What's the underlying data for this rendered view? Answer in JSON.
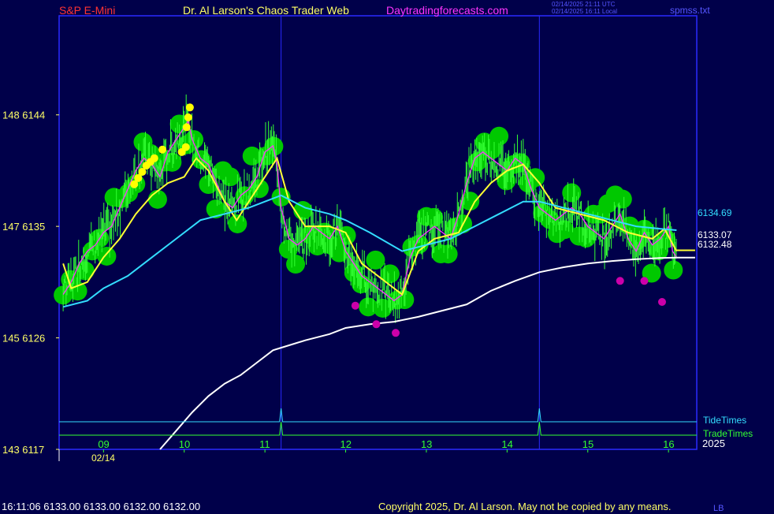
{
  "header": {
    "symbol": "S&P E-Mini",
    "site_title": "Dr. Al Larson's Chaos Trader Web",
    "site_url": "Daytradingforecasts.com",
    "time_utc": "02/14/2025 21:11 UTC",
    "time_local": "02/14/2025 16:11 Local",
    "file_name": "spmss.txt"
  },
  "footer": {
    "quote_line": "16:11:06  6133.00 6133.00 6132.00 6132.00",
    "copyright": "Copyright 2025, Dr. Al Larson. May not be copied by any means.",
    "corner_tag": "LB"
  },
  "colors": {
    "background": "#00004a",
    "axis": "#2a2aff",
    "price_bars": "#33ff33",
    "green_circles": "#00c800",
    "yellow_line": "#ffff33",
    "magenta_line": "#ff33ff",
    "cyan_line": "#33ddff",
    "white_line": "#ffffff",
    "tide_line": "#33ddff",
    "trade_line": "#33ff33",
    "title_red": "#ff3333",
    "site_url_color": "#ff33ff"
  },
  "chart_data": {
    "type": "line",
    "ylim": [
      6117,
      6152
    ],
    "xlim": [
      8.45,
      16.35
    ],
    "y_ticks": [
      {
        "label": "148  6144",
        "value": 6144
      },
      {
        "label": "147  6135",
        "value": 6135
      },
      {
        "label": "145  6126",
        "value": 6126
      },
      {
        "label": "143  6117",
        "value": 6117
      }
    ],
    "x_ticks": [
      {
        "label": "09",
        "value": 9
      },
      {
        "label": "10",
        "value": 10
      },
      {
        "label": "11",
        "value": 11
      },
      {
        "label": "12",
        "value": 12
      },
      {
        "label": "13",
        "value": 13
      },
      {
        "label": "14",
        "value": 14
      },
      {
        "label": "15",
        "value": 15
      },
      {
        "label": "16",
        "value": 16
      }
    ],
    "date_label": "02/14",
    "year_label": "2025",
    "vertical_markers": [
      11.2,
      14.4
    ],
    "series": [
      {
        "name": "price",
        "x": [
          8.5,
          8.6,
          8.7,
          8.8,
          8.9,
          9.0,
          9.1,
          9.2,
          9.3,
          9.4,
          9.5,
          9.6,
          9.7,
          9.8,
          9.9,
          10.0,
          10.05,
          10.1,
          10.2,
          10.3,
          10.4,
          10.5,
          10.6,
          10.7,
          10.8,
          10.9,
          11.0,
          11.1,
          11.15,
          11.2,
          11.3,
          11.4,
          11.5,
          11.6,
          11.7,
          11.8,
          11.9,
          12.0,
          12.1,
          12.2,
          12.3,
          12.4,
          12.5,
          12.6,
          12.7,
          12.8,
          12.9,
          13.0,
          13.1,
          13.2,
          13.3,
          13.4,
          13.5,
          13.6,
          13.7,
          13.8,
          13.9,
          14.0,
          14.1,
          14.2,
          14.3,
          14.4,
          14.5,
          14.6,
          14.7,
          14.8,
          14.9,
          15.0,
          15.1,
          15.2,
          15.3,
          15.4,
          15.5,
          15.6,
          15.7,
          15.8,
          15.9,
          16.0,
          16.05,
          16.1
        ],
        "y": [
          6129.5,
          6130.5,
          6132.0,
          6133.0,
          6133.5,
          6134.5,
          6135.0,
          6136.5,
          6138.0,
          6139.5,
          6140.5,
          6140.0,
          6139.0,
          6141.0,
          6142.0,
          6143.0,
          6143.5,
          6142.0,
          6140.5,
          6140.0,
          6138.5,
          6137.0,
          6136.5,
          6137.5,
          6138.0,
          6139.0,
          6141.0,
          6141.5,
          6140.0,
          6136.5,
          6134.0,
          6133.5,
          6134.0,
          6135.0,
          6134.5,
          6134.0,
          6135.0,
          6133.0,
          6132.0,
          6131.0,
          6130.5,
          6130.0,
          6129.5,
          6129.0,
          6129.5,
          6132.5,
          6134.0,
          6134.5,
          6135.0,
          6134.5,
          6134.0,
          6136.0,
          6138.5,
          6140.5,
          6141.0,
          6140.5,
          6140.0,
          6139.5,
          6140.5,
          6140.0,
          6138.0,
          6136.5,
          6136.0,
          6135.5,
          6136.0,
          6136.5,
          6136.0,
          6135.0,
          6134.5,
          6134.0,
          6135.0,
          6136.0,
          6134.0,
          6133.0,
          6134.5,
          6133.5,
          6134.0,
          6135.0,
          6133.0,
          6132.5
        ]
      },
      {
        "name": "yellow",
        "x": [
          8.5,
          8.6,
          8.8,
          9.0,
          9.2,
          9.4,
          9.6,
          9.8,
          10.0,
          10.15,
          10.3,
          10.5,
          10.65,
          10.8,
          11.0,
          11.15,
          11.3,
          11.5,
          11.8,
          12.0,
          12.2,
          12.5,
          12.7,
          12.9,
          13.1,
          13.4,
          13.6,
          13.8,
          14.0,
          14.2,
          14.4,
          14.6,
          14.9,
          15.2,
          15.5,
          15.8,
          15.95,
          16.1
        ],
        "y": [
          6132.0,
          6130.0,
          6130.5,
          6132.5,
          6134.0,
          6136.0,
          6137.5,
          6138.5,
          6139.0,
          6140.5,
          6139.5,
          6137.0,
          6135.5,
          6137.0,
          6139.0,
          6140.5,
          6137.0,
          6135.0,
          6135.0,
          6134.5,
          6132.0,
          6130.5,
          6129.5,
          6133.0,
          6134.0,
          6134.5,
          6137.0,
          6138.5,
          6139.5,
          6140.0,
          6138.5,
          6136.5,
          6136.0,
          6135.5,
          6134.5,
          6134.0,
          6134.8,
          6133.0
        ]
      },
      {
        "name": "cyan",
        "x": [
          8.5,
          8.8,
          9.0,
          9.3,
          9.6,
          9.9,
          10.2,
          10.5,
          10.8,
          11.0,
          11.2,
          11.5,
          11.8,
          12.0,
          12.3,
          12.7,
          13.0,
          13.3,
          13.6,
          13.9,
          14.2,
          14.4,
          14.7,
          15.0,
          15.3,
          15.6,
          15.9,
          16.1
        ],
        "y": [
          6128.5,
          6129.0,
          6130.0,
          6131.0,
          6132.5,
          6134.0,
          6135.5,
          6136.0,
          6136.5,
          6137.0,
          6137.5,
          6136.5,
          6136.0,
          6135.5,
          6134.5,
          6133.0,
          6133.5,
          6134.0,
          6135.0,
          6136.0,
          6137.0,
          6137.0,
          6136.5,
          6136.0,
          6135.5,
          6135.0,
          6134.8,
          6134.69
        ]
      },
      {
        "name": "white",
        "x": [
          9.7,
          9.9,
          10.1,
          10.3,
          10.5,
          10.7,
          10.9,
          11.1,
          11.2,
          11.5,
          11.8,
          12.0,
          12.3,
          12.6,
          12.9,
          13.2,
          13.5,
          13.8,
          14.1,
          14.4,
          14.7,
          15.0,
          15.3,
          15.6,
          15.9,
          16.1
        ],
        "y": [
          6117.0,
          6118.5,
          6120.0,
          6121.3,
          6122.3,
          6123.0,
          6124.0,
          6125.0,
          6125.2,
          6125.8,
          6126.3,
          6126.8,
          6127.1,
          6127.3,
          6127.7,
          6128.2,
          6128.7,
          6129.8,
          6130.6,
          6131.3,
          6131.7,
          6132.0,
          6132.2,
          6132.35,
          6132.45,
          6132.48
        ]
      }
    ],
    "last_values": [
      {
        "label": "6134.69",
        "value": 6134.69,
        "color": "#33ddff"
      },
      {
        "label": "6133.07",
        "value": 6133.07,
        "color": "#ffffff"
      },
      {
        "label": "6132.48",
        "value": 6132.48,
        "color": "#ffffff"
      }
    ],
    "yellow_dots": [
      [
        9.38,
        6138.4
      ],
      [
        9.43,
        6138.9
      ],
      [
        9.48,
        6139.4
      ],
      [
        9.53,
        6139.9
      ],
      [
        9.58,
        6140.2
      ],
      [
        9.63,
        6140.5
      ],
      [
        9.73,
        6141.2
      ],
      [
        9.97,
        6141.0
      ],
      [
        10.02,
        6141.4
      ],
      [
        10.03,
        6143.0
      ],
      [
        10.05,
        6143.8
      ],
      [
        10.07,
        6144.6
      ]
    ],
    "magenta_dots": [
      [
        12.12,
        6128.6
      ],
      [
        12.38,
        6127.1
      ],
      [
        12.62,
        6126.4
      ],
      [
        15.4,
        6130.6
      ],
      [
        15.7,
        6130.6
      ],
      [
        15.92,
        6128.9
      ]
    ],
    "bottom_lines": [
      {
        "name": "TideTimes",
        "color": "#33ddff",
        "spikes": [
          11.2,
          14.4
        ]
      },
      {
        "name": "TradeTimes",
        "color": "#33ff33",
        "spikes": [
          11.2,
          14.4
        ]
      }
    ]
  }
}
